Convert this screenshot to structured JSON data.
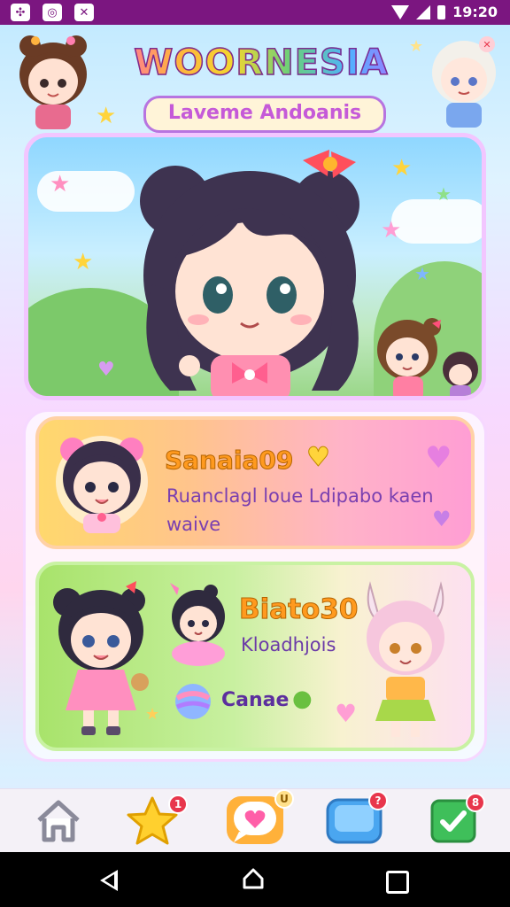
{
  "status_bar": {
    "time": "19:20"
  },
  "header": {
    "title": "WOORNESIA",
    "subtitle": "Laveme Andoanis"
  },
  "cards": [
    {
      "name": "Sanaia09",
      "description": "Ruanclagl loue Ldipabo kaen waive"
    },
    {
      "name": "Biato30",
      "description": "Kloadhjois",
      "tag": "Canae"
    }
  ],
  "nav": [
    {
      "icon": "home-icon"
    },
    {
      "icon": "star-icon",
      "badge": "1"
    },
    {
      "icon": "chat-heart-icon",
      "badge": "U"
    },
    {
      "icon": "message-icon",
      "badge": "?"
    },
    {
      "icon": "check-icon",
      "badge": "8"
    }
  ],
  "colors": {
    "status_bar": "#7b1680",
    "accent": "#ff9a1f",
    "purple": "#7a3fb0"
  }
}
